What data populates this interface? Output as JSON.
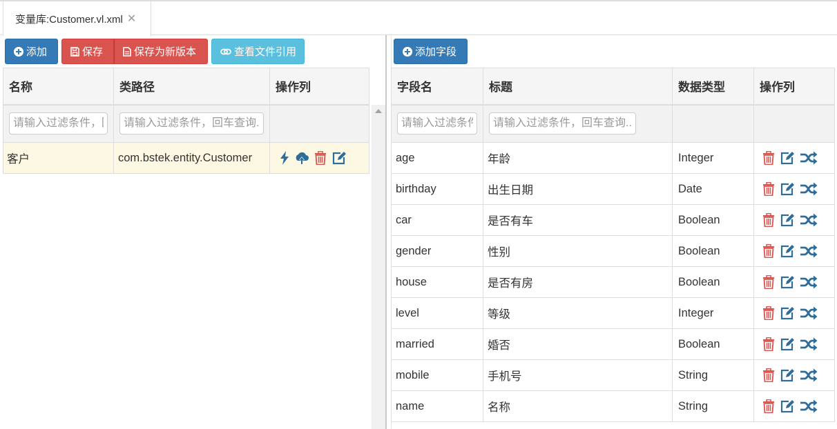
{
  "tab": {
    "label": "变量库:Customer.vl.xml",
    "close": "✕"
  },
  "toolbar": {
    "add": "添加",
    "save": "保存",
    "save_as_new": "保存为新版本",
    "view_refs": "查看文件引用",
    "add_field": "添加字段"
  },
  "left_table": {
    "headers": [
      "名称",
      "类路径",
      "操作列"
    ],
    "filter_placeholder": "请输入过滤条件，回车查询...",
    "rows": [
      {
        "name": "客户",
        "class_path": "com.bstek.entity.Customer"
      }
    ]
  },
  "right_table": {
    "headers": [
      "字段名",
      "标题",
      "数据类型",
      "操作列"
    ],
    "filter_placeholder": "请输入过滤条件，回车查询...",
    "rows": [
      {
        "field": "age",
        "title": "年龄",
        "type": "Integer"
      },
      {
        "field": "birthday",
        "title": "出生日期",
        "type": "Date"
      },
      {
        "field": "car",
        "title": "是否有车",
        "type": "Boolean"
      },
      {
        "field": "gender",
        "title": "性别",
        "type": "Boolean"
      },
      {
        "field": "house",
        "title": "是否有房",
        "type": "Boolean"
      },
      {
        "field": "level",
        "title": "等级",
        "type": "Integer"
      },
      {
        "field": "married",
        "title": "婚否",
        "type": "Boolean"
      },
      {
        "field": "mobile",
        "title": "手机号",
        "type": "String"
      },
      {
        "field": "name",
        "title": "名称",
        "type": "String"
      }
    ]
  },
  "icons": {
    "add": "plus-circle-icon",
    "save": "save-icon",
    "save_as_new": "file-icon",
    "view_refs": "link-icon",
    "lightning": "lightning-icon",
    "upload": "cloud-upload-icon",
    "delete": "trash-icon",
    "edit": "edit-icon",
    "shuffle": "shuffle-icon"
  },
  "colors": {
    "primary": "#337ab7",
    "danger": "#d9534f",
    "info": "#5bc0de",
    "selected_row": "#fcf8e3",
    "icon_blue": "#2e6c9a",
    "icon_red": "#d9534f"
  }
}
